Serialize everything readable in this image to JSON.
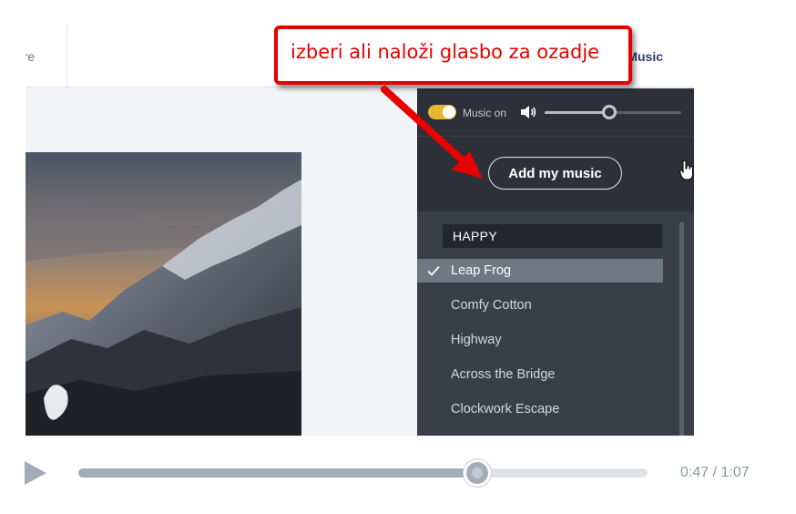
{
  "header": {
    "share_label": "hare",
    "music_tab_label": "Music"
  },
  "music_panel": {
    "music_toggle": {
      "on": true,
      "label": "Music on"
    },
    "volume_level": 0.47,
    "add_music_label": "Add my music",
    "category": "HAPPY",
    "tracks": [
      {
        "title": "Leap Frog",
        "selected": true
      },
      {
        "title": "Comfy Cotton",
        "selected": false
      },
      {
        "title": "Highway",
        "selected": false
      },
      {
        "title": "Across the Bridge",
        "selected": false
      },
      {
        "title": "Clockwork Escape",
        "selected": false
      }
    ]
  },
  "callout": {
    "text": "izberi ali naloži glasbo za ozadje"
  },
  "player": {
    "progress": 0.7,
    "time_label": "0:47 / 1:07"
  },
  "colors": {
    "accent_toggle": "#e8b72f",
    "callout_red": "#e60000",
    "panel_bg": "#2d3038",
    "list_bg": "#3a3e48",
    "selected_row": "#707784"
  },
  "icons": [
    "speaker-icon",
    "checkmark-icon",
    "hand-cursor-icon",
    "play-icon",
    "callout-arrow-icon"
  ]
}
